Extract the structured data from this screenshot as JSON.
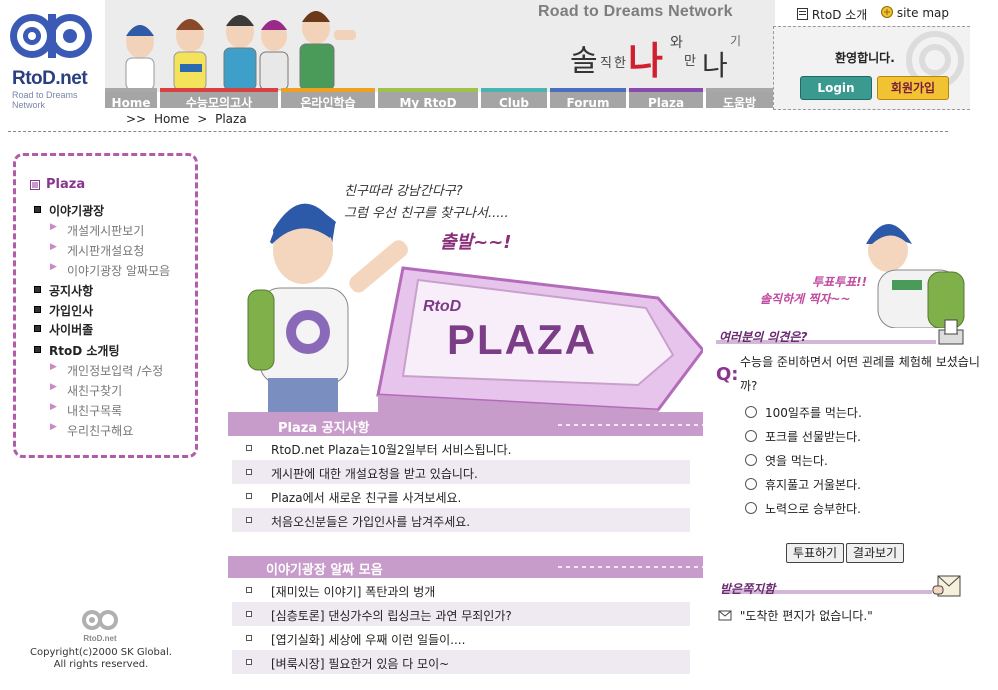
{
  "header": {
    "logo_title": "RtoD.net",
    "logo_sub": "Road to Dreams Network",
    "network_title": "Road to Dreams Network",
    "slogan": [
      "솔",
      "직",
      "한",
      "나",
      "와",
      "만",
      "나",
      "기"
    ],
    "nav": [
      "Home",
      "수능모의고사",
      "온라인학습",
      "My RtoD",
      "Club",
      "Forum",
      "Plaza",
      "도움방"
    ],
    "nav_colors": [
      "#a8a8a8",
      "#d94040",
      "#f0a020",
      "#9ec24a",
      "#48b5b0",
      "#4a6fc0",
      "#8a4ab0",
      "#a8a8a8"
    ],
    "links": {
      "about": "RtoD 소개",
      "sitemap": "site map"
    },
    "welcome": "환영합니다.",
    "login": "Login",
    "join": "회원가입"
  },
  "breadcrumb": {
    "prefix": ">>",
    "home": "Home",
    "sep": ">",
    "current": "Plaza"
  },
  "sidebar": {
    "title": "Plaza",
    "items": [
      {
        "label": "이야기광장",
        "sub": [
          "개설게시판보기",
          "게시판개설요청",
          "이야기광장 알짜모음"
        ]
      },
      {
        "label": "공지사항",
        "sub": []
      },
      {
        "label": "가입인사",
        "sub": []
      },
      {
        "label": "사이버졸",
        "sub": []
      },
      {
        "label": "RtoD 소개팅",
        "sub": [
          "개인정보입력 /수정",
          "새친구찾기",
          "내친구목록",
          "우리친구해요"
        ]
      }
    ]
  },
  "footer": {
    "logo": "RtoD.net",
    "copyright": "Copyright(c)2000 SK Global.",
    "rights": "All rights reserved."
  },
  "hero": {
    "line1": "친구따라 강남간다구?",
    "line2": "그럼 우선 친구를 찾구나서.....",
    "line3": "출발~~!",
    "rtod": "RtoD",
    "plaza": "PLAZA"
  },
  "notice": {
    "title": "Plaza 공지사항",
    "items": [
      "RtoD.net Plaza는10월2일부터 서비스됩니다.",
      "게시판에 대한 개설요청을 받고 있습니다.",
      "Plaza에서 새로운 친구를 사겨보세요.",
      "처음오신분들은 가입인사를 남겨주세요."
    ]
  },
  "best": {
    "title": "이야기광장 알짜 모음",
    "items": [
      "[재미있는 이야기] 폭탄과의 벙개",
      "[심층토론] 댄싱가수의 립싱크는 과연 무죄인가?",
      "[엽기실화] 세상에 우째 이런 일들이....",
      "[벼룩시장] 필요한거 있음 다 모이~"
    ]
  },
  "poll": {
    "tag1": "투표투표!!",
    "tag2": "솔직하게 찍자~~",
    "head": "여러분의 의견은?",
    "q_mark": "Q:",
    "question": "수능을 준비하면서 어떤 괸례를 체험해 보셨습니까?",
    "options": [
      "100일주를 먹는다.",
      "포크를 선물받는다.",
      "엿을 먹는다.",
      "휴지풀고 거울본다.",
      "노력으로 승부한다."
    ],
    "vote": "투표하기",
    "results": "결과보기"
  },
  "letters": {
    "head": "받은쪽지함",
    "message": "\"도착한 편지가 없습니다.\""
  }
}
